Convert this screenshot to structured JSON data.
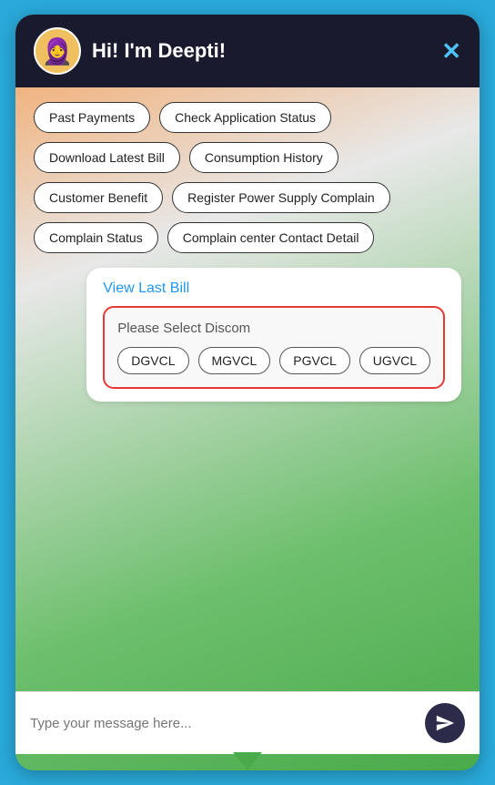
{
  "header": {
    "title": "Hi! I'm Deepti!",
    "close_label": "✕",
    "avatar_emoji": "🧕"
  },
  "quick_options": [
    {
      "id": "past-payments",
      "label": "Past Payments"
    },
    {
      "id": "check-application-status",
      "label": "Check Application Status"
    },
    {
      "id": "download-latest-bill",
      "label": "Download Latest Bill"
    },
    {
      "id": "consumption-history",
      "label": "Consumption History"
    },
    {
      "id": "customer-benefit",
      "label": "Customer Benefit"
    },
    {
      "id": "register-power-supply-complain",
      "label": "Register Power Supply Complain"
    },
    {
      "id": "complain-status",
      "label": "Complain Status"
    },
    {
      "id": "complain-center-contact-detail",
      "label": "Complain center Contact Detail"
    }
  ],
  "message": {
    "view_last_bill_label": "View Last Bill"
  },
  "discom_selector": {
    "label": "Please Select Discom",
    "options": [
      "DGVCL",
      "MGVCL",
      "PGVCL",
      "UGVCL"
    ]
  },
  "footer": {
    "input_placeholder": "Type your message here..."
  }
}
